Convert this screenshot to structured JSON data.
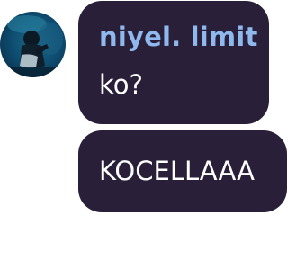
{
  "avatar": {
    "icon": "user-avatar-photo"
  },
  "messages": [
    {
      "sender": "niyel. limit",
      "text": "ko?"
    },
    {
      "text": "KOCELLAAA"
    }
  ],
  "colors": {
    "bubble_bg": "#2a1f39",
    "sender_name": "#8fb9ee",
    "message_text": "#ffffff",
    "page_bg": "#ffffff"
  }
}
